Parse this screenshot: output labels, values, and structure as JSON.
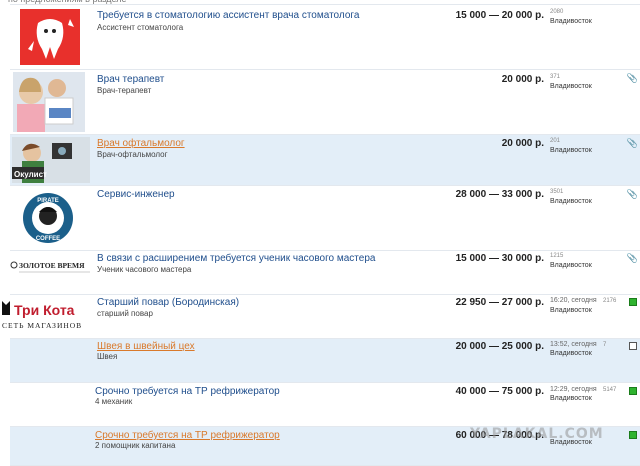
{
  "listings": [
    {
      "title": "Требуется в стоматологию ассистент врача стоматолога",
      "subtitle": "Ассистент стоматолога",
      "salary": "15 000 — 20 000 р.",
      "time": "",
      "views": "2080",
      "city": "Владивосток",
      "visited": false
    },
    {
      "title": "Врач терапевт",
      "subtitle": "Врач-терапевт",
      "salary": "20 000 р.",
      "time": "",
      "views": "371",
      "city": "Владивосток",
      "visited": false
    },
    {
      "title": "Врач офтальмолог",
      "subtitle": "Врач-офтальмолог",
      "salary": "20 000 р.",
      "time": "",
      "views": "201",
      "city": "Владивосток",
      "visited": true,
      "image_label": "Окулист"
    },
    {
      "title": "Сервис-инженер",
      "subtitle": "",
      "salary": "28 000 — 33 000 р.",
      "time": "",
      "views": "3501",
      "city": "Владивосток",
      "visited": false,
      "image_label": "PIRATE COFFEE"
    },
    {
      "title": "В связи с расширением требуется ученик часового мастера",
      "subtitle": "Ученик часового мастера",
      "salary": "15 000 — 30 000 р.",
      "time": "",
      "views": "1215",
      "city": "Владивосток",
      "visited": false,
      "image_label": "ЗОЛОТОЕ ВРЕМЯ"
    },
    {
      "title": "Старший повар (Бородинская)",
      "subtitle": "старший повар",
      "salary": "22 950 — 27 000 р.",
      "time": "16:20, сегодня",
      "views": "2176",
      "city": "Владивосток",
      "visited": false,
      "image_label": "Три Кота",
      "image_sub": "СЕТЬ МАГАЗИНОВ"
    },
    {
      "title": "Швея в швейный цех",
      "subtitle": "Швея",
      "salary": "20 000 — 25 000 р.",
      "time": "13:52, сегодня",
      "views": "7",
      "city": "Владивосток",
      "visited": true
    },
    {
      "title": "Срочно требуется на ТР рефрижератор",
      "subtitle": "4 механик",
      "salary": "40 000 — 75 000 р.",
      "time": "12:29, сегодня",
      "views": "5147",
      "city": "Владивосток",
      "visited": false
    },
    {
      "title": "Срочно требуется на ТР рефрижератор",
      "subtitle": "2 помощник капитана",
      "salary": "60 000 — 78 000 р.",
      "time": "",
      "views": "",
      "city": "Владивосток",
      "visited": true
    }
  ],
  "watermark": "YAPLAKAL.COM",
  "colors": {
    "link": "#1f4e8c",
    "visited": "#d9792b",
    "highlight": "#e3eef8"
  }
}
